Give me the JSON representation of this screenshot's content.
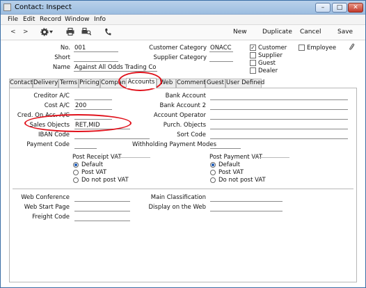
{
  "window": {
    "title": "Contact: Inspect",
    "minimize": "–",
    "maximize": "□",
    "close": "✕"
  },
  "menu": [
    "File",
    "Edit",
    "Record",
    "Window",
    "Info"
  ],
  "toolbar": {
    "prev": "<",
    "next": ">",
    "new": "New",
    "duplicate": "Duplicate",
    "cancel": "Cancel",
    "save": "Save"
  },
  "header": {
    "no_label": "No.",
    "no_value": "001",
    "short_label": "Short",
    "short_value": "",
    "name_label": "Name",
    "name_value": "Against All Odds Trading Co",
    "customer_category_label": "Customer Category",
    "customer_category_value": "ONACC",
    "supplier_category_label": "Supplier Category",
    "supplier_category_value": "",
    "checks": [
      {
        "label": "Customer",
        "checked": true
      },
      {
        "label": "Supplier",
        "checked": false
      },
      {
        "label": "Guest",
        "checked": false
      },
      {
        "label": "Dealer",
        "checked": false
      }
    ],
    "employee_label": "Employee",
    "employee_checked": false
  },
  "tabs": [
    "Contact",
    "Delivery",
    "Terms",
    "Pricing",
    "Company",
    "Accounts",
    "Web",
    "Comments",
    "Guest",
    "User Defined"
  ],
  "active_tab": "Accounts",
  "accounts": {
    "creditor_ac_label": "Creditor A/C",
    "creditor_ac_value": "",
    "cost_ac_label": "Cost A/C",
    "cost_ac_value": "200",
    "cred_on_acc_label": "Cred. On Acc. A/C",
    "cred_on_acc_value": "",
    "sales_objects_label": "Sales Objects",
    "sales_objects_value": "RET,MID",
    "iban_code_label": "IBAN Code",
    "iban_code_value": "",
    "payment_code_label": "Payment Code",
    "payment_code_value": "",
    "bank_account_label": "Bank Account",
    "bank_account_value": "",
    "bank_account2_label": "Bank Account 2",
    "bank_account2_value": "",
    "account_operator_label": "Account Operator",
    "account_operator_value": "",
    "purch_objects_label": "Purch. Objects",
    "purch_objects_value": "",
    "sort_code_label": "Sort Code",
    "sort_code_value": "",
    "withholding_label": "Withholding Payment Modes",
    "withholding_value": "",
    "post_receipt_vat_label": "Post Receipt VAT",
    "post_receipt_vat_options": [
      {
        "label": "Default",
        "selected": true
      },
      {
        "label": "Post VAT",
        "selected": false
      },
      {
        "label": "Do not post VAT",
        "selected": false
      }
    ],
    "post_payment_vat_label": "Post Payment VAT",
    "post_payment_vat_options": [
      {
        "label": "Default",
        "selected": true
      },
      {
        "label": "Post VAT",
        "selected": false
      },
      {
        "label": "Do not post VAT",
        "selected": false
      }
    ],
    "web_conference_label": "Web Conference",
    "web_conference_value": "",
    "web_start_page_label": "Web Start Page",
    "web_start_page_value": "",
    "freight_code_label": "Freight Code",
    "freight_code_value": "",
    "main_classification_label": "Main Classification",
    "main_classification_value": "",
    "display_on_web_label": "Display on the Web",
    "display_on_web_value": ""
  },
  "colors": {
    "highlight": "#e0101a",
    "radio_selected": "#1f5cb8"
  }
}
